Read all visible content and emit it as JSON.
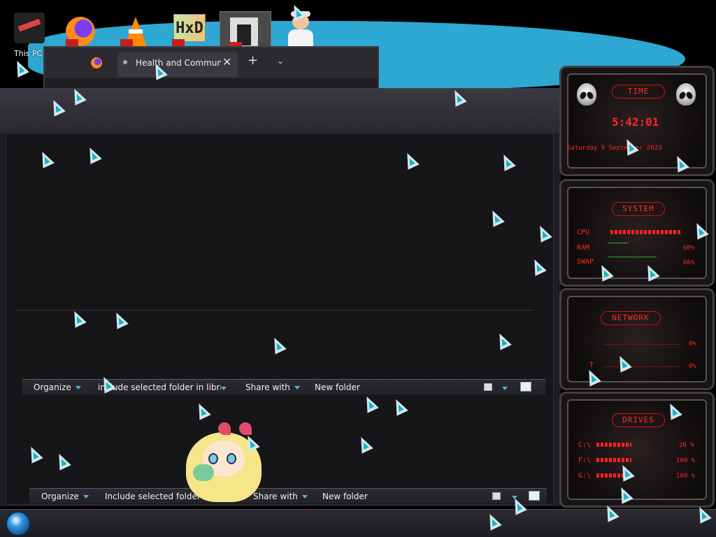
{
  "desktop": {
    "icons": [
      {
        "label": "This PC"
      }
    ]
  },
  "browser": {
    "tab_title": "Health and Communic",
    "new_tab_symbol": "+",
    "close_symbol": "✕",
    "menu_symbol": "⌄"
  },
  "explorer": {
    "cmdbar_upper": {
      "organize": "Organize",
      "include": "include selected folder in library",
      "share": "Share with",
      "new_folder": "New folder"
    },
    "cmdbar_lower": {
      "organize": "Organize",
      "include": "Include selected folder in library",
      "share": "Share with",
      "new_folder": "New folder"
    }
  },
  "gadgets": {
    "time": {
      "title": "TIME",
      "clock": "5:42:01",
      "date": "Saturday 9 September 2023"
    },
    "system": {
      "title": "SYSTEM",
      "rows": [
        {
          "label": "CPU",
          "value": ""
        },
        {
          "label": "RAM",
          "value": "60%"
        },
        {
          "label": "SWAP",
          "value": "66%"
        }
      ]
    },
    "network": {
      "title": "NETWORK",
      "rows": [
        {
          "label": "",
          "value": "0%"
        },
        {
          "label": "T",
          "value": "0%"
        }
      ]
    },
    "drives": {
      "title": "DRIVES",
      "rows": [
        {
          "label": "C:\\",
          "value": "26 %"
        },
        {
          "label": "F:\\",
          "value": "100 %"
        },
        {
          "label": "G:\\",
          "value": "100 %"
        }
      ]
    }
  },
  "colors": {
    "accent_blue": "#2ea7d2",
    "gadget_red": "#ff2424",
    "cursor_cyan": "#1ab0c6"
  }
}
